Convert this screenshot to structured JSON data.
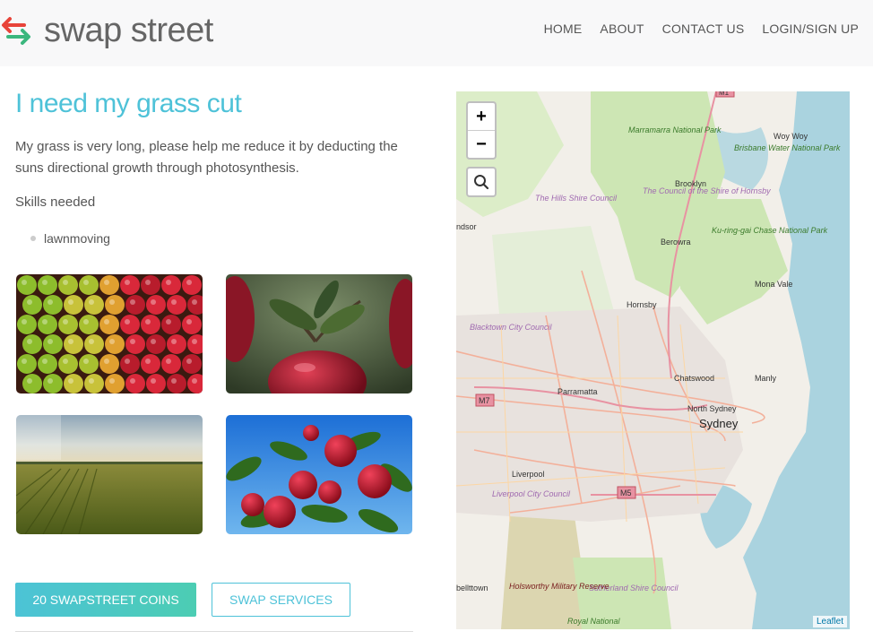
{
  "header": {
    "brand": "swap street",
    "nav": [
      "HOME",
      "ABOUT",
      "CONTACT US",
      "LOGIN/SIGN UP"
    ]
  },
  "listing": {
    "title": "I need my grass cut",
    "description": "My grass is very long, please help me reduce it by deducting the suns directional growth through photosynthesis.",
    "skills_label": "Skills needed",
    "skills": [
      "lawnmoving"
    ]
  },
  "actions": {
    "coins_button": "20 SWAPSTREET COINS",
    "swap_button": "SWAP SERVICES"
  },
  "map": {
    "zoom_in": "+",
    "zoom_out": "−",
    "attribution": "Leaflet",
    "labels": {
      "windsor": "ndsor",
      "marramarra": "Marramarra National Park",
      "brisbane_water": "Brisbane Water National Park",
      "woywoy": "Woy Woy",
      "hills": "The Hills Shire Council",
      "hornsby_council": "The Council of the Shire of Hornsby",
      "brooklyn": "Brooklyn",
      "berowra": "Berowra",
      "kuringgai": "Ku-ring-gai Chase National Park",
      "monavale": "Mona Vale",
      "hornsby": "Hornsby",
      "blacktown": "Blacktown City Council",
      "chatswood": "Chatswood",
      "manly": "Manly",
      "parramatta": "Parramatta",
      "m7": "M7",
      "northsydney": "North Sydney",
      "sydney": "Sydney",
      "liverpool": "Liverpool",
      "liverpool_council": "Liverpool City Council",
      "m5": "M5",
      "campbelltown": "bellttown",
      "holsworthy": "Holsworthy Military Reserve",
      "sutherland": "Sutherland Shire Council",
      "royal": "Royal National",
      "m1": "M1"
    }
  },
  "colors": {
    "accent": "#4ec2d8",
    "accent2": "#4ccdb3",
    "navbar_bg": "#f8f8f9",
    "logo_red": "#e8443a",
    "logo_green": "#3bb77e"
  },
  "icons": [
    "swap-arrows-icon",
    "bullet-icon",
    "search-icon"
  ]
}
